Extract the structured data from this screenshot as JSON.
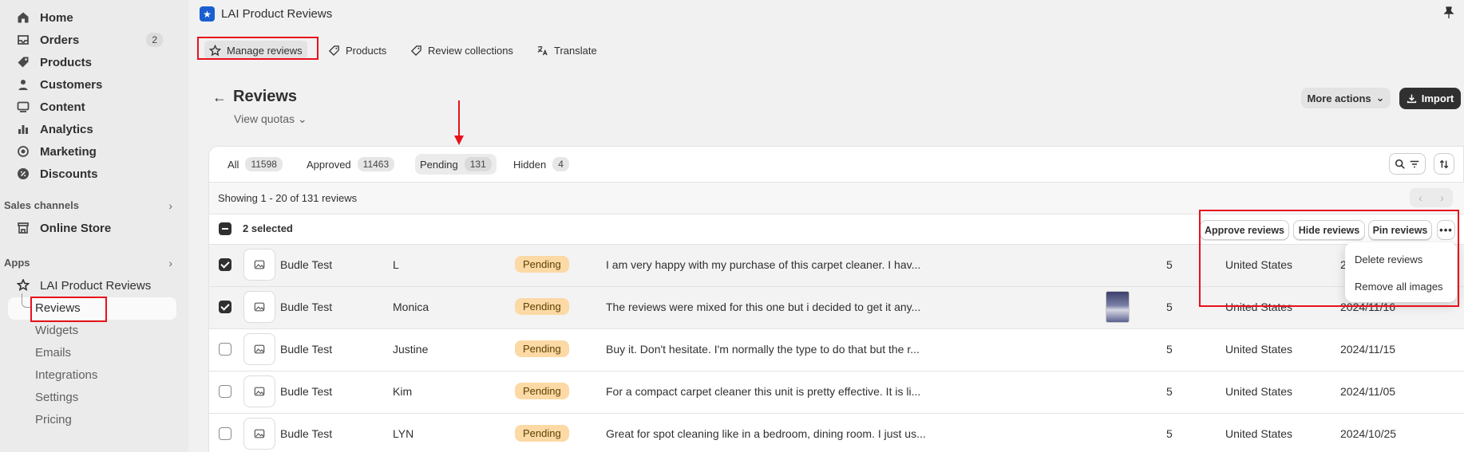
{
  "sidebar": {
    "items": [
      {
        "label": "Home",
        "icon": "home-icon"
      },
      {
        "label": "Orders",
        "icon": "orders-icon",
        "badge": "2"
      },
      {
        "label": "Products",
        "icon": "tag-icon"
      },
      {
        "label": "Customers",
        "icon": "person-icon"
      },
      {
        "label": "Content",
        "icon": "content-icon"
      },
      {
        "label": "Analytics",
        "icon": "bar-chart-icon"
      },
      {
        "label": "Marketing",
        "icon": "target-icon"
      },
      {
        "label": "Discounts",
        "icon": "discount-icon"
      }
    ],
    "sales_channels_label": "Sales channels",
    "online_store": "Online Store",
    "apps_label": "Apps",
    "app_name": "LAI Product Reviews",
    "sub_items": [
      "Reviews",
      "Widgets",
      "Emails",
      "Integrations",
      "Settings",
      "Pricing"
    ]
  },
  "header": {
    "app_title": "LAI Product Reviews"
  },
  "top_tabs": [
    "Manage reviews",
    "Products",
    "Review collections",
    "Translate"
  ],
  "page": {
    "title": "Reviews",
    "view_quotas": "View quotas",
    "more_actions": "More actions",
    "import": "Import"
  },
  "status_tabs": [
    {
      "label": "All",
      "count": "11598"
    },
    {
      "label": "Approved",
      "count": "11463"
    },
    {
      "label": "Pending",
      "count": "131"
    },
    {
      "label": "Hidden",
      "count": "4"
    }
  ],
  "showing_text": "Showing 1 - 20 of 131 reviews",
  "selected_text": "2 selected",
  "bulk_actions": {
    "approve": "Approve reviews",
    "hide": "Hide reviews",
    "pin": "Pin reviews",
    "more": "•••"
  },
  "dropdown": {
    "delete": "Delete reviews",
    "remove_images": "Remove all images"
  },
  "rows": [
    {
      "product": "Budle Test",
      "reviewer": "L",
      "status": "Pending",
      "text": "I am very happy with my purchase of this carpet cleaner. I hav...",
      "rating": "5",
      "country": "United States",
      "date": "2",
      "checked": true
    },
    {
      "product": "Budle Test",
      "reviewer": "Monica",
      "status": "Pending",
      "text": "The reviews were mixed for this one but i decided to get it any...",
      "rating": "5",
      "country": "United States",
      "date": "2024/11/16",
      "checked": true
    },
    {
      "product": "Budle Test",
      "reviewer": "Justine",
      "status": "Pending",
      "text": "Buy it. Don't hesitate. I'm normally the type to do that but the r...",
      "rating": "5",
      "country": "United States",
      "date": "2024/11/15",
      "checked": false
    },
    {
      "product": "Budle Test",
      "reviewer": "Kim",
      "status": "Pending",
      "text": "For a compact carpet cleaner this unit is pretty effective. It is li...",
      "rating": "5",
      "country": "United States",
      "date": "2024/11/05",
      "checked": false
    },
    {
      "product": "Budle Test",
      "reviewer": "LYN",
      "status": "Pending",
      "text": "Great for spot cleaning like in a bedroom, dining room. I just us...",
      "rating": "5",
      "country": "United States",
      "date": "2024/10/25",
      "checked": false
    }
  ],
  "colors": {
    "highlight": "#e8111b",
    "pending_pill": "#fcd9a5",
    "primary_button": "#303030"
  }
}
